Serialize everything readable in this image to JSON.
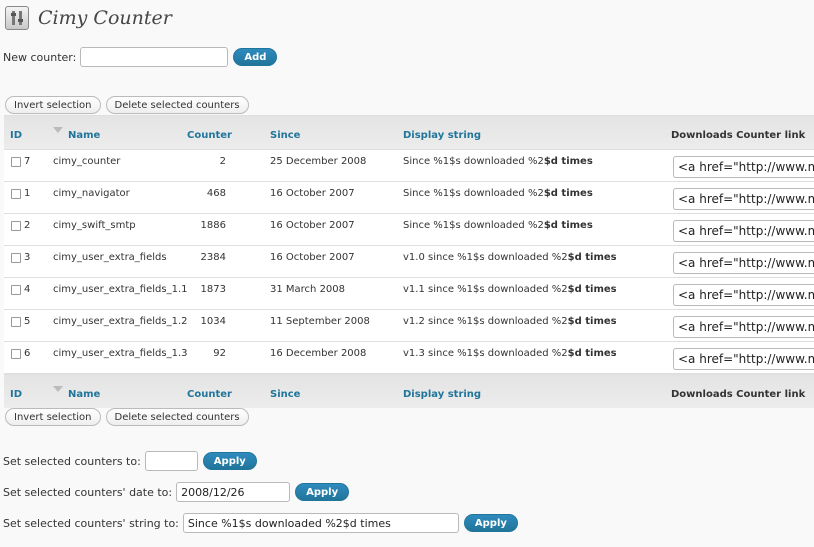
{
  "header": {
    "title": "Cimy Counter",
    "icon": "tools-icon"
  },
  "new_counter": {
    "label": "New counter:",
    "value": "",
    "button": "Add"
  },
  "bulk_actions": {
    "invert": "Invert selection",
    "delete": "Delete selected counters"
  },
  "table": {
    "columns": {
      "id": "ID",
      "name": "Name",
      "counter": "Counter",
      "since": "Since",
      "display": "Display string",
      "link": "Downloads Counter link"
    },
    "rows": [
      {
        "id": "7",
        "name": "cimy_counter",
        "counter": "2",
        "since": "25 December 2008",
        "display_pre": "Since %1$s downloaded %2",
        "display_bold": "$d times",
        "link": "<a href=\"http://www.marco"
      },
      {
        "id": "1",
        "name": "cimy_navigator",
        "counter": "468",
        "since": "16 October 2007",
        "display_pre": "Since %1$s downloaded %2",
        "display_bold": "$d times",
        "link": "<a href=\"http://www.marco"
      },
      {
        "id": "2",
        "name": "cimy_swift_smtp",
        "counter": "1886",
        "since": "16 October 2007",
        "display_pre": "Since %1$s downloaded %2",
        "display_bold": "$d times",
        "link": "<a href=\"http://www.marco"
      },
      {
        "id": "3",
        "name": "cimy_user_extra_fields",
        "counter": "2384",
        "since": "16 October 2007",
        "display_pre": "v1.0 since %1$s downloaded %2",
        "display_bold": "$d times",
        "link": "<a href=\"http://www.marco"
      },
      {
        "id": "4",
        "name": "cimy_user_extra_fields_1.1",
        "counter": "1873",
        "since": "31 March 2008",
        "display_pre": "v1.1 since %1$s downloaded %2",
        "display_bold": "$d times",
        "link": "<a href=\"http://www.marco"
      },
      {
        "id": "5",
        "name": "cimy_user_extra_fields_1.2",
        "counter": "1034",
        "since": "11 September 2008",
        "display_pre": "v1.2 since %1$s downloaded %2",
        "display_bold": "$d times",
        "link": "<a href=\"http://www.marco"
      },
      {
        "id": "6",
        "name": "cimy_user_extra_fields_1.3",
        "counter": "92",
        "since": "16 December 2008",
        "display_pre": "v1.3 since %1$s downloaded %2",
        "display_bold": "$d times",
        "link": "<a href=\"http://www.marco"
      }
    ]
  },
  "set_counter": {
    "label": "Set selected counters to:",
    "value": "",
    "button": "Apply"
  },
  "set_date": {
    "label": "Set selected counters' date to:",
    "value": "2008/12/26",
    "button": "Apply"
  },
  "set_string": {
    "label": "Set selected counters' string to:",
    "value": "Since %1$s downloaded %2$d times",
    "button": "Apply"
  },
  "colors": {
    "accent": "#21759b",
    "header_bg": "#e4e4e4",
    "border": "#dfdfdf"
  }
}
